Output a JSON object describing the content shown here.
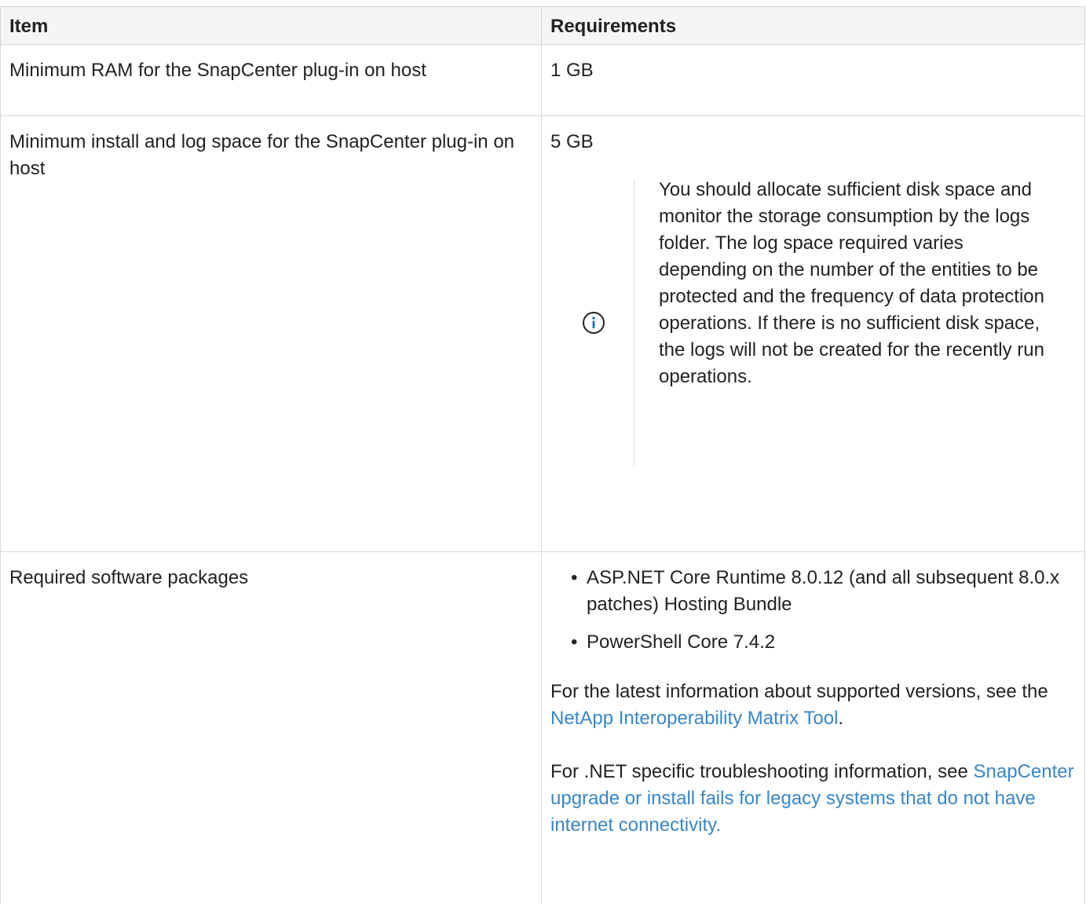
{
  "table": {
    "headers": {
      "item": "Item",
      "requirements": "Requirements"
    },
    "rows": [
      {
        "item": "Minimum RAM for the SnapCenter plug-in on host",
        "requirement": "1 GB"
      },
      {
        "item": "Minimum install and log space for the SnapCenter plug-in on host",
        "requirement": "5 GB",
        "note": {
          "icon": "info-icon",
          "text": "You should allocate sufficient disk space and monitor the storage consumption by the logs folder. The log space required varies depending on the number of the entities to be protected and the frequency of data protection operations. If there is no sufficient disk space, the logs will not be created for the recently run operations."
        }
      },
      {
        "item": "Required software packages",
        "bullets": [
          "ASP.NET Core Runtime 8.0.12 (and all subsequent 8.0.x patches) Hosting Bundle",
          "PowerShell Core 7.4.2"
        ],
        "para1": {
          "prefix": "For the latest information about supported versions, see the ",
          "link": "NetApp Interoperability Matrix Tool",
          "suffix": "."
        },
        "para2": {
          "prefix": "For .NET specific troubleshooting information, see ",
          "link": "SnapCenter upgrade or install fails for legacy systems that do not have internet connectivity."
        }
      }
    ]
  },
  "colors": {
    "link": "#3a86c5",
    "info_icon": "#1a6fc2",
    "header_bg": "#f5f5f5",
    "border": "#d7d7d7"
  }
}
